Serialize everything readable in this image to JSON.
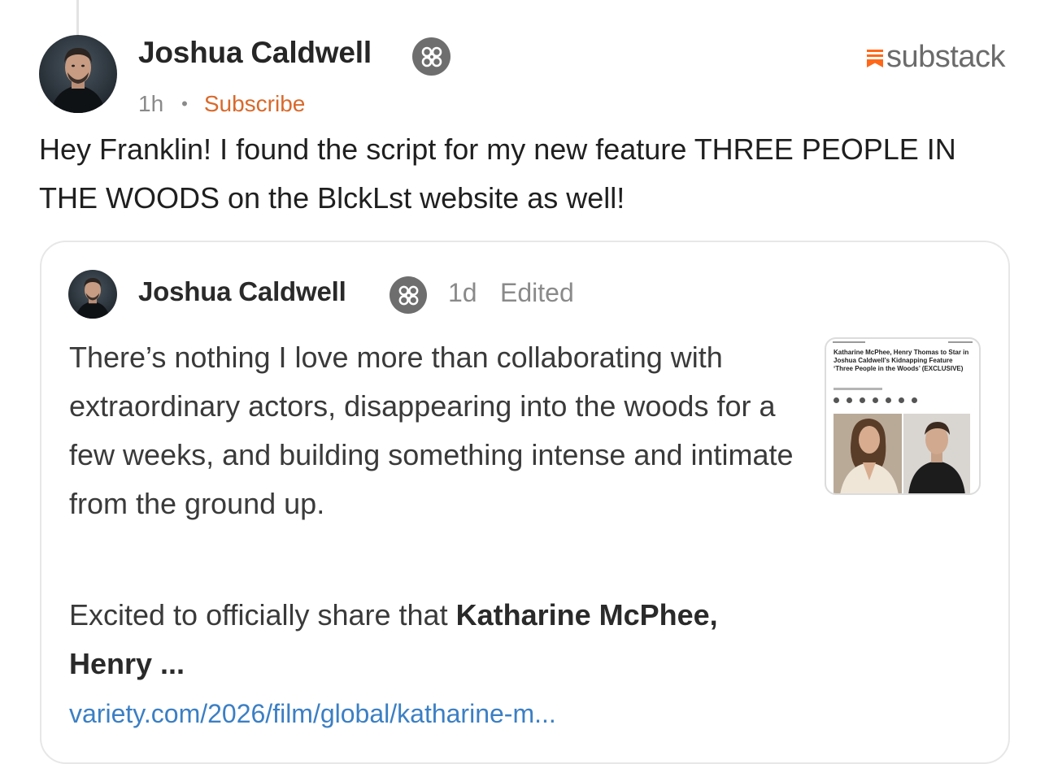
{
  "post": {
    "author": "Joshua Caldwell",
    "time": "1h",
    "separator": "•",
    "subscribe_label": "Subscribe",
    "body": "Hey Franklin! I found the script for my new feature THREE PEOPLE IN THE WOODS on the BlckLst website as well!",
    "avatar_icon": "avatar-photo",
    "badge_icon": "flower-badge-icon"
  },
  "brand": {
    "name": "substack",
    "icon": "substack-logo-icon",
    "accent": "#ff6719"
  },
  "quoted": {
    "author": "Joshua Caldwell",
    "time": "1d",
    "edited_label": "Edited",
    "paragraph1": "There’s nothing I love more than collaborating with extraordinary actors, disappearing into the woods for a few weeks, and building something intense and intimate from the ground up.",
    "paragraph2_lead": "Excited to officially share that ",
    "paragraph2_bold": "Katharine McPhee, Henry ...",
    "link": "variety.com/2026/film/global/katharine-m...",
    "thumbnail": {
      "headline": "Katharine McPhee, Henry Thomas to Star in Joshua Caldwell’s Kidnapping Feature ‘Three People in the Woods’ (EXCLUSIVE)"
    }
  },
  "colors": {
    "subscribe": "#d9692b",
    "link": "#3b7fc4",
    "badge": "#6e6e6e",
    "muted": "#8a8a8a"
  }
}
